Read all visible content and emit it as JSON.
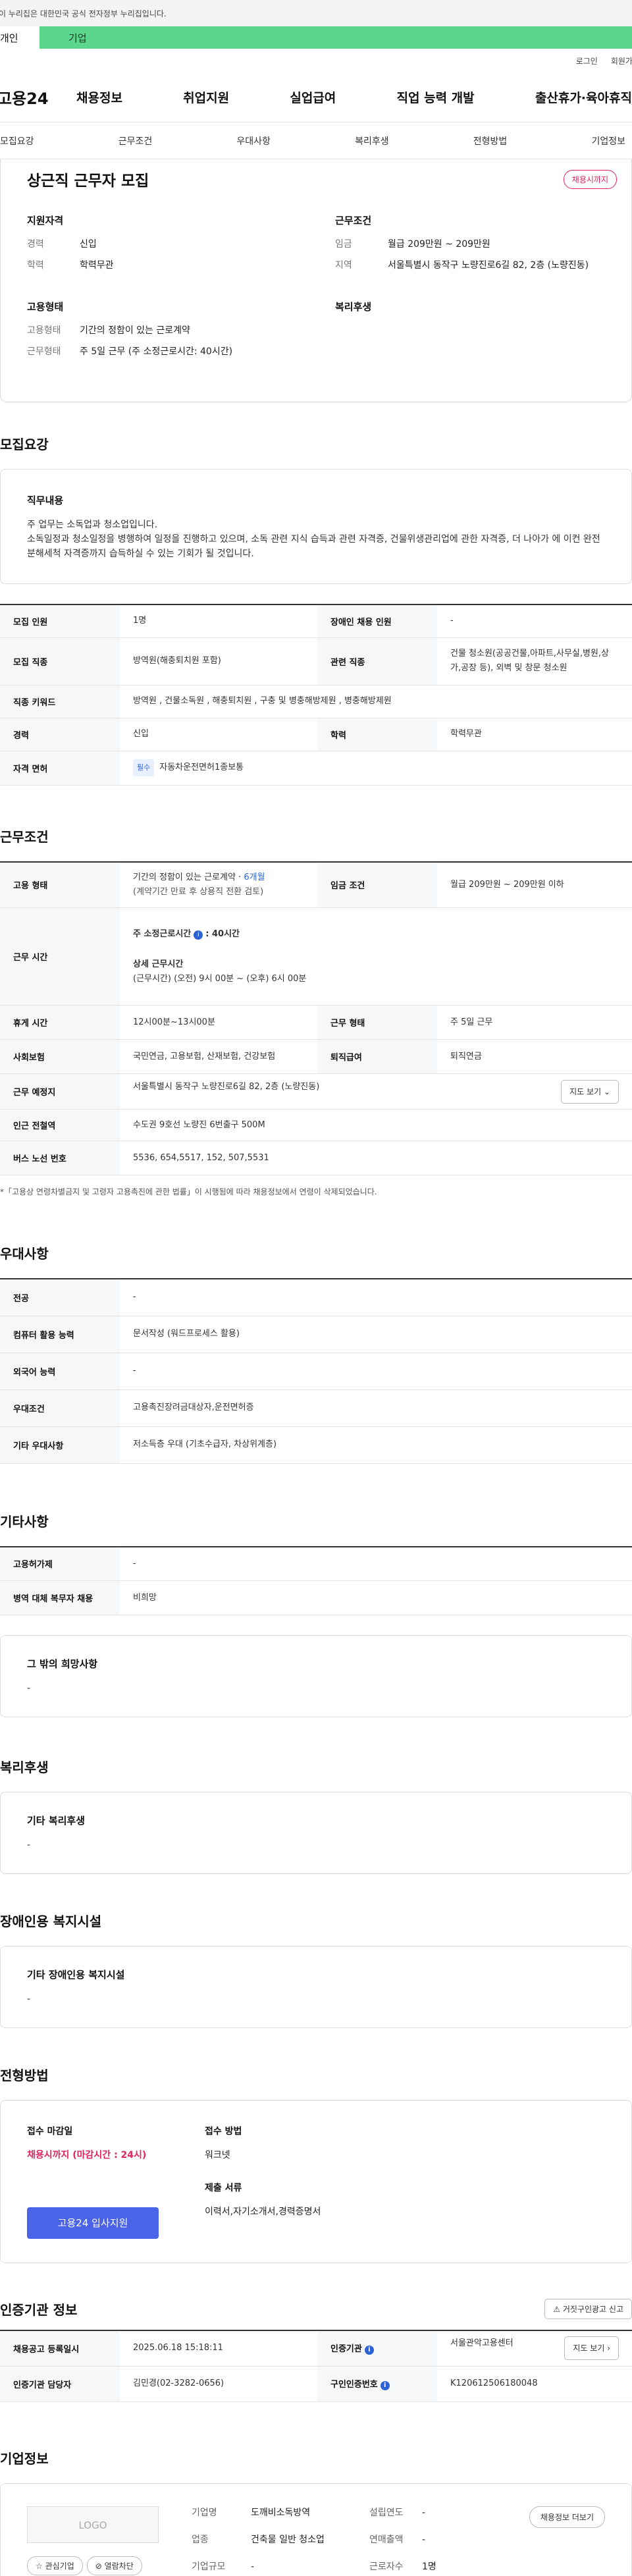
{
  "gov_bar": {
    "text": "이 누리집은 대한민국 공식 전자정부 누리집입니다."
  },
  "type_tabs": {
    "personal": "개인",
    "company": "기업"
  },
  "util_links": {
    "login": "로그인",
    "signup": "회원가입"
  },
  "gnb": {
    "logo": "고용24",
    "items": [
      "채용정보",
      "취업지원",
      "실업급여",
      "직업 능력 개발",
      "출산휴가·육아휴직"
    ]
  },
  "anchor_nav": [
    "모집요강",
    "근무조건",
    "우대사항",
    "복리후생",
    "전형방법",
    "기업정보"
  ],
  "summary": {
    "title": "상근직 근무자 모집",
    "badge": "채용시까지",
    "qual": {
      "heading": "지원자격",
      "rows": [
        {
          "k": "경력",
          "v": "신입"
        },
        {
          "k": "학력",
          "v": "학력무관"
        }
      ]
    },
    "cond": {
      "heading": "근무조건",
      "rows": [
        {
          "k": "임금",
          "v": "월급 209만원 ~ 209만원"
        },
        {
          "k": "지역",
          "v": "서울특별시 동작구 노량진로6길 82, 2층 (노량진동)"
        }
      ]
    },
    "emp": {
      "heading": "고용형태",
      "rows": [
        {
          "k": "고용형태",
          "v": "기간의 정함이 있는 근로계약"
        },
        {
          "k": "근무형태",
          "v": "주 5일 근무 (주 소정근로시간: 40시간)"
        }
      ]
    },
    "welfare": {
      "heading": "복리후생"
    }
  },
  "recruit": {
    "title": "모집요강",
    "duty_heading": "직무내용",
    "duty_text": "주 업무는 소독업과 청소업입니다.\n소독일정과 청소일정을 병행하여 일정을 진행하고 있으며, 소독 관련 지식 습득과 관련 자격증, 건물위생관리업에 관한 자격증, 더 나아가 에 이컨 완전분해세척 자격증까지 습득하실 수 있는 기회가 될 것입니다.",
    "rows": {
      "count_k": "모집 인원",
      "count_v": "1명",
      "disabled_k": "장애인 채용 인원",
      "disabled_v": "-",
      "job_k": "모집 직종",
      "job_v": "방역원(해충퇴치원 포함)",
      "rel_k": "관련 직종",
      "rel_v": "건물 청소원(공공건물,아파트,사무실,병원,상가,공장 등), 외벽 및 창문 청소원",
      "kw_k": "직종 키워드",
      "kw_v": "방역원 , 건물소독원 , 해충퇴치원 , 구충 및 병충해방제원 , 병충해방제원",
      "career_k": "경력",
      "career_v": "신입",
      "edu_k": "학력",
      "edu_v": "학력무관",
      "license_k": "자격 면허",
      "license_chip": "필수",
      "license_v": "자동차운전면허1종보통"
    }
  },
  "work": {
    "title": "근무조건",
    "emp_k": "고용 형태",
    "emp_v1": "기간의 정함이 있는 근로계약 · ",
    "emp_period": "6개월",
    "emp_v2": "(계약기간 만료 후 상용직 전환 검토)",
    "wage_k": "임금 조건",
    "wage_v": "월급 209만원 ~ 209만원 이하",
    "hours_k": "근무 시간",
    "hours_std_label": "주 소정근로시간",
    "hours_std_v": ": 40시간",
    "hours_detail_label": "상세 근무시간",
    "hours_detail_v": "(근무시간) (오전) 9시 00분 ~ (오후) 6시 00분",
    "rest_k": "휴게 시간",
    "rest_v": "12시00분~13시00분",
    "form_k": "근무 형태",
    "form_v": "주 5일 근무",
    "ins_k": "사회보험",
    "ins_v": "국민연금, 고용보험, 산재보험, 건강보험",
    "sev_k": "퇴직급여",
    "sev_v": "퇴직연금",
    "loc_k": "근무 예정지",
    "loc_v": "서울특별시 동작구 노량진로6길 82, 2층 (노량진동)",
    "map_btn": "지도 보기 ⌄",
    "sub_k": "인근 전철역",
    "sub_v": "수도권 9호선 노량진 6번출구 500M",
    "bus_k": "버스 노선 번호",
    "bus_v": "5536, 654,5517, 152, 507,5531",
    "note": "*「고용상 연령차별금지 및 고령자 고용촉진에 관한 법률」이 시행됨에 따라 채용정보에서 연령이 삭제되었습니다."
  },
  "pref": {
    "title": "우대사항",
    "rows": [
      {
        "k": "전공",
        "v": "-"
      },
      {
        "k": "컴퓨터 활용 능력",
        "v": "문서작성 (워드프로세스 활용)"
      },
      {
        "k": "외국어 능력",
        "v": "-"
      },
      {
        "k": "우대조건",
        "v": "고용촉진장려금대상자,운전면허증"
      },
      {
        "k": "기타 우대사항",
        "v": "저소득층 우대 (기초수급자, 차상위계층)"
      }
    ]
  },
  "etc": {
    "title": "기타사항",
    "rows": [
      {
        "k": "고용허가제",
        "v": "-"
      },
      {
        "k": "병역 대체 복무자 채용",
        "v": "비희망"
      }
    ],
    "box_heading": "그 밖의 희망사항",
    "box_text": "-"
  },
  "welfare": {
    "title": "복리후생",
    "box_heading": "기타 복리후생",
    "box_text": "-"
  },
  "disabled": {
    "title": "장애인용 복지시설",
    "box_heading": "기타 장애인용 복지시설",
    "box_text": "-"
  },
  "screening": {
    "title": "전형방법",
    "deadline_k": "접수 마감일",
    "deadline_v": "채용시까지 (마감시간 : 24시)",
    "apply_btn": "고용24 입사지원",
    "method_k": "접수 방법",
    "method_v": "워크넷",
    "docs_k": "제출 서류",
    "docs_v": "이력서,자기소개서,경력증명서"
  },
  "cert": {
    "title": "인증기관 정보",
    "report_btn": "⚠ 거짓구인광고 신고",
    "reg_k": "채용공고 등록일시",
    "reg_v": "2025.06.18 15:18:11",
    "org_k": "인증기관",
    "org_v": "서울관악고용센터",
    "map_btn": "지도 보기 ›",
    "mgr_k": "인증기관 담당자",
    "mgr_v": "김민경(02-3282-0656)",
    "num_k": "구인인증번호",
    "num_v": "K120612506180048"
  },
  "company": {
    "title": "기업정보",
    "logo": "LOGO",
    "fav_btn": "☆ 관심기업",
    "block_btn": "⊘ 열람차단",
    "name_k": "기업명",
    "name_v": "도깨비소독방역",
    "ind_k": "업종",
    "ind_v": "건축물 일반 청소업",
    "size_k": "기업규모",
    "size_v": "-",
    "year_k": "설립연도",
    "year_v": "-",
    "sales_k": "연매출액",
    "sales_v": "-",
    "emp_k": "근로자수",
    "emp_v": "1명",
    "more_btn": "채용정보 더보기"
  }
}
